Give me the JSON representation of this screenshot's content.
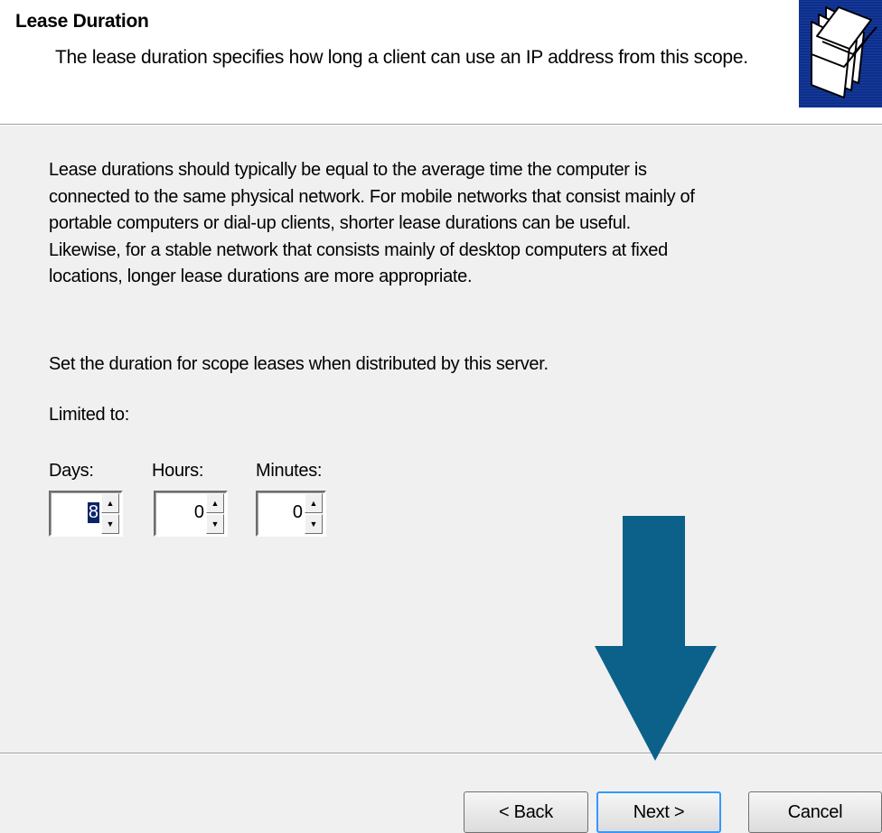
{
  "header": {
    "title": "Lease Duration",
    "subtitle": "The lease duration specifies how long a client can use an IP address from this scope.",
    "icon": "folders-icon"
  },
  "body": {
    "description_lines": [
      "Lease durations should typically be equal to the average time the computer is",
      "connected to the same physical network. For mobile networks that consist mainly of",
      "portable computers or dial-up clients, shorter lease durations can be useful.",
      "Likewise, for a stable network that consists mainly of desktop computers at fixed",
      "locations, longer lease durations are more appropriate."
    ],
    "instruction": "Set the duration for scope leases when distributed by this server.",
    "limited_label": "Limited to:",
    "fields": {
      "days": {
        "label": "Days:",
        "value": "8"
      },
      "hours": {
        "label": "Hours:",
        "value": "0"
      },
      "minutes": {
        "label": "Minutes:",
        "value": "0"
      }
    }
  },
  "footer": {
    "back_label": "< Back",
    "next_label": "Next >",
    "cancel_label": "Cancel"
  },
  "colors": {
    "header_bg": "#ffffff",
    "body_bg": "#f0f0f0",
    "icon_bg": "#0c2f8e",
    "arrow": "#0b6189",
    "next_focus_border": "#3399ff"
  }
}
